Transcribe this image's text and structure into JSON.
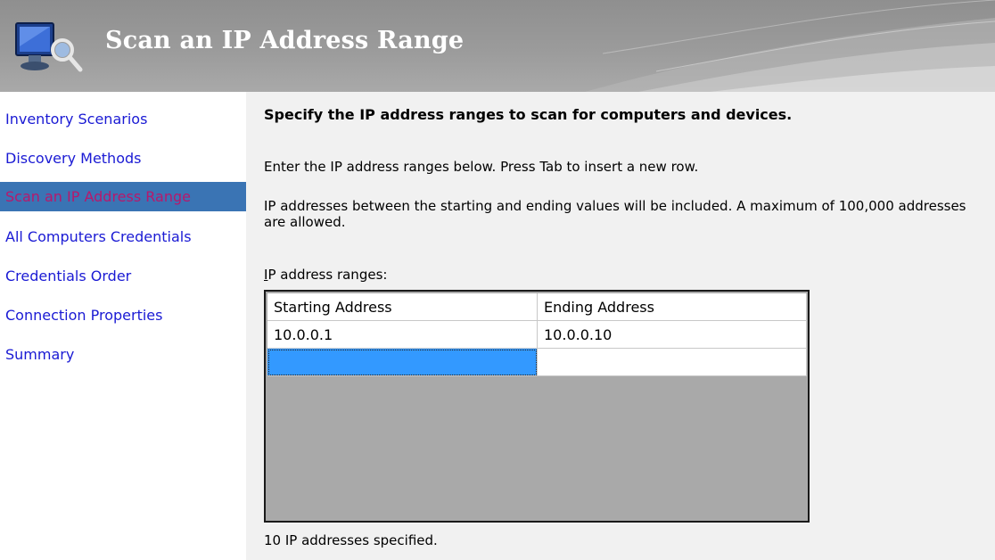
{
  "banner": {
    "title": "Scan an IP Address Range",
    "icon": "computer-monitor-icon"
  },
  "sidebar": {
    "items": [
      {
        "label": "Inventory Scenarios",
        "active": false
      },
      {
        "label": "Discovery Methods",
        "active": false
      },
      {
        "label": "Scan an IP Address Range",
        "active": true
      },
      {
        "label": "All Computers Credentials",
        "active": false
      },
      {
        "label": "Credentials Order",
        "active": false
      },
      {
        "label": "Connection Properties",
        "active": false
      },
      {
        "label": "Summary",
        "active": false
      }
    ]
  },
  "main": {
    "heading": "Specify the IP address ranges to scan for computers and devices.",
    "instruction": "Enter the IP address ranges below. Press Tab to insert a new row.",
    "note": "IP addresses between the starting and ending values will be included. A maximum of 100,000 addresses are allowed.",
    "grid_label_accel": "I",
    "grid_label_rest": "P address ranges:",
    "grid": {
      "columns": [
        "Starting Address",
        "Ending Address"
      ],
      "rows": [
        [
          "10.0.0.1",
          "10.0.0.10"
        ],
        [
          "",
          ""
        ]
      ]
    },
    "status": "10 IP addresses specified."
  },
  "colors": {
    "link": "#1a1ad4",
    "active_bg": "#3a74b4",
    "active_text": "#b7186c",
    "selection": "#3399ff",
    "grid_empty": "#a9a9a9"
  }
}
